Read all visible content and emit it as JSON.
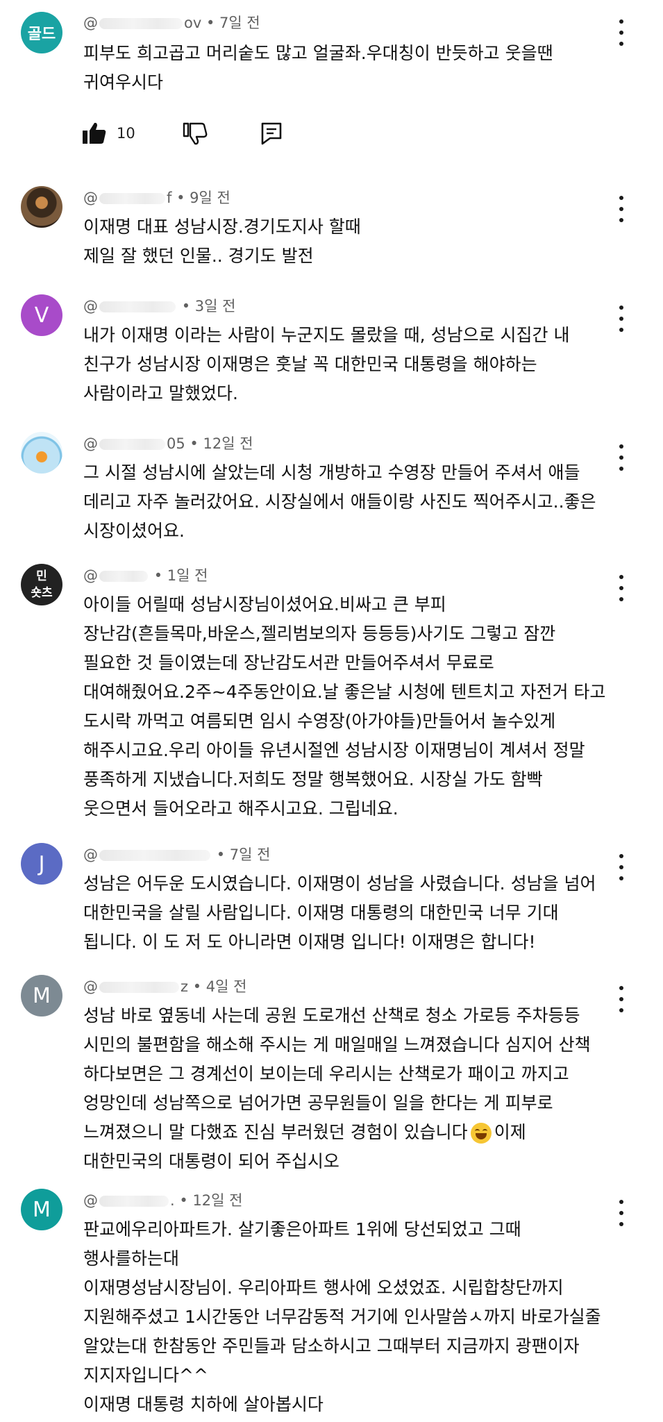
{
  "comments": [
    {
      "avatar": {
        "text": "골드",
        "color": "#1aa3a3"
      },
      "time": "7일 전",
      "handle_prefix": "@",
      "handle_suffix": "ov",
      "lines": [
        "피부도 희고곱고 머리숱도 많고 얼굴좌.우대칭이  반듯하고 웃을땐",
        "귀여우시다"
      ],
      "likes": "10"
    },
    {
      "avatar": {
        "text": "",
        "color": "#5a4632"
      },
      "time": "9일 전",
      "handle_prefix": "@",
      "handle_suffix": "f",
      "lines": [
        "이재명 대표 성남시장.경기도지사 할때",
        "제일 잘 했던 인물.. 경기도 발전"
      ]
    },
    {
      "avatar": {
        "text": "V",
        "color": "#a84bc9"
      },
      "time": "3일 전",
      "handle_prefix": "@",
      "handle_suffix": "",
      "lines": [
        "내가 이재명 이라는 사람이 누군지도 몰랐을 때, 성남으로 시집간 내",
        "친구가 성남시장 이재명은 훗날 꼭 대한민국 대통령을 해야하는",
        "사람이라고 말했었다."
      ]
    },
    {
      "avatar": {
        "text": "",
        "color": "#bfe3f5"
      },
      "time": "12일 전",
      "handle_prefix": "@",
      "handle_suffix": "05",
      "lines": [
        "그 시절 성남시에 살았는데 시청 개방하고 수영장 만들어 주셔서 애들",
        "데리고 자주 놀러갔어요. 시장실에서 애들이랑 사진도 찍어주시고..좋은",
        "시장이셨어요."
      ]
    },
    {
      "avatar": {
        "text": "민\n숏츠",
        "color": "#222222"
      },
      "time": "1일 전",
      "handle_prefix": "@",
      "handle_suffix": "",
      "lines": [
        "아이들 어릴때 성남시장님이셨어요.비싸고 큰 부피",
        "장난감(흔들목마,바운스,젤리범보의자 등등등)사기도 그렇고 잠깐",
        "필요한 것 들이였는데 장난감도서관 만들어주셔서 무료로",
        "대여해줬어요.2주~4주동안이요.날 좋은날 시청에 텐트치고 자전거 타고",
        "도시락 까먹고 여름되면 임시 수영장(아가야들)만들어서 놀수있게",
        "해주시고요.우리 아이들 유년시절엔 성남시장 이재명님이 계셔서 정말",
        "풍족하게 지냈습니다.저희도 정말 행복했어요. 시장실 가도 함빡",
        "웃으면서 들어오라고 해주시고요. 그립네요."
      ]
    },
    {
      "avatar": {
        "text": "J",
        "color": "#5b6bc4"
      },
      "time": "7일 전",
      "handle_prefix": "@",
      "handle_suffix": "",
      "lines": [
        "성남은 어두운 도시였습니다.  이재명이 성남을 사렸습니다.  성남을 넘어",
        "대한민국을 살릴 사람입니다.  이재명 대통령의  대한민국 너무 기대",
        "됩니다.  이 도 저 도 아니라면 이재명 입니다!   이재명은 합니다!"
      ]
    },
    {
      "avatar": {
        "text": "M",
        "color": "#7d8a93"
      },
      "time": "4일 전",
      "handle_prefix": "@",
      "handle_suffix": "z",
      "lines": [
        "성남 바로 옆동네 사는데 공원 도로개선 산책로 청소 가로등 주차등등",
        "시민의 불편함을 해소해 주시는 게 매일매일 느껴졌습니다 심지어 산책",
        "하다보면은 그 경계선이 보이는데 우리시는 산책로가 패이고 까지고",
        "엉망인데 성남쪽으로 넘어가면 공무원들이 일을 한다는 게 피부로",
        "느껴졌으니 말 다했죠 진심 부러웠던 경험이 있습니다",
        "대한민국의 대통령이 되어 주십시오"
      ],
      "emoji_line_tail": "이제"
    },
    {
      "avatar": {
        "text": "M",
        "color": "#0f9d9a"
      },
      "time": "12일 전",
      "handle_prefix": "@",
      "handle_suffix": ".",
      "lines": [
        "판교에우리아파트가. 살기좋은아파트 1위에 당선되었고 그때",
        "행사를하는대",
        "이재명성남시장님이. 우리아파트 행사에 오셨었죠. 시립합창단까지",
        "지원해주셨고 1시간동안 너무감동적 거기에 인사말씀ㅅ까지 바로가실줄",
        "알았는대 한참동안 주민들과 담소하시고 그때부터 지금까지 광팬이자",
        "지지자입니다^^",
        "이재명 대통령 치하에 살아봅시다"
      ]
    }
  ]
}
